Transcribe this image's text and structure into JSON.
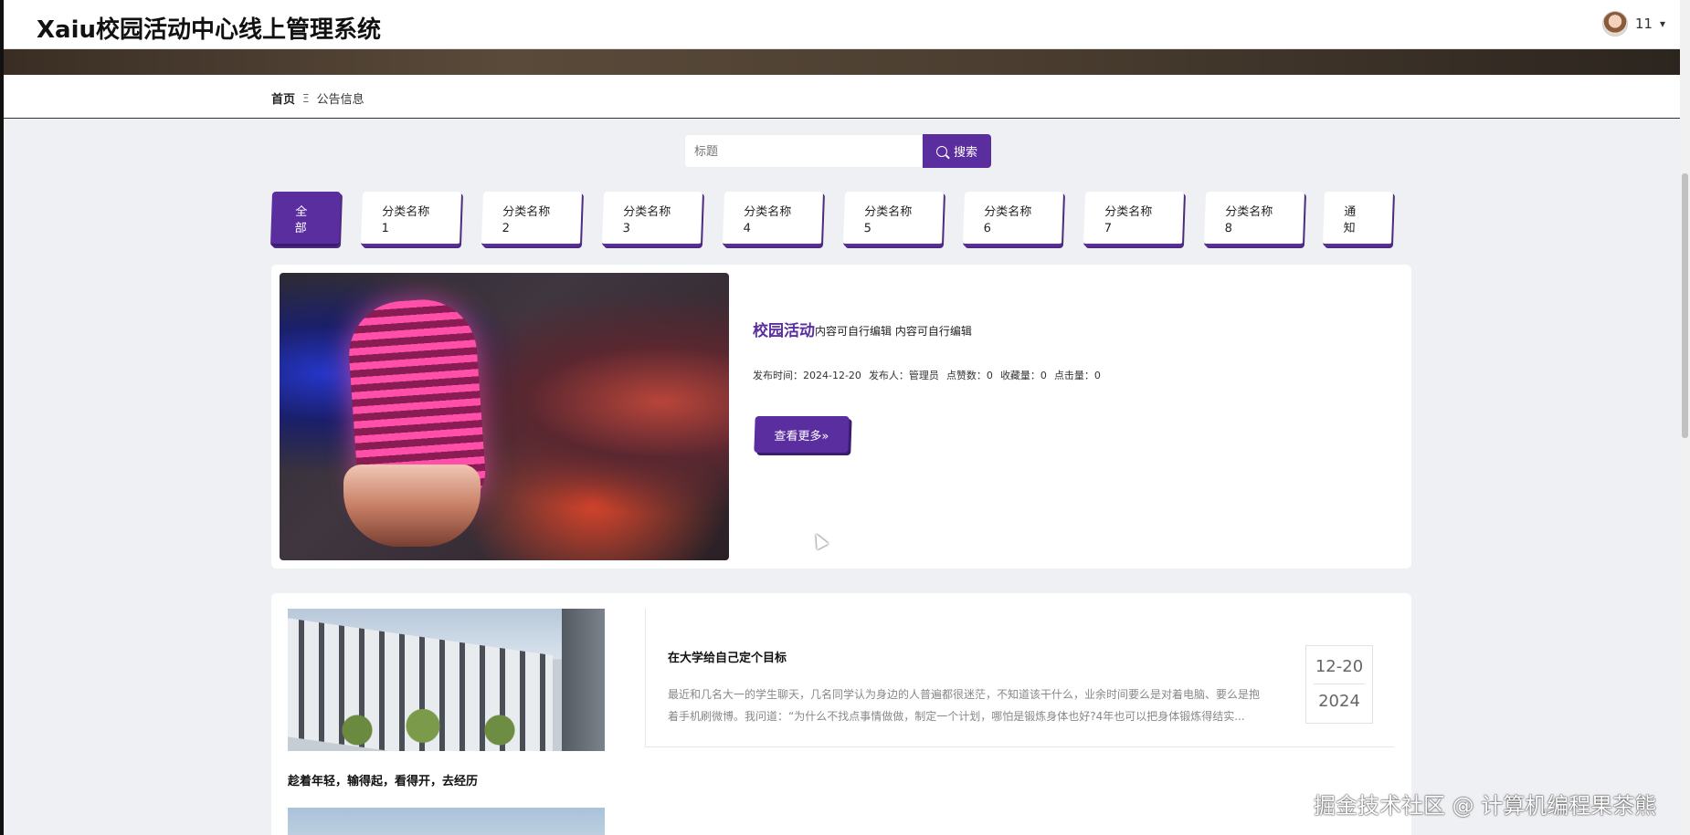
{
  "header": {
    "app_title": "Xaiu校园活动中心线上管理系统",
    "user_name": "11",
    "caret": "▾"
  },
  "breadcrumb": {
    "home": "首页",
    "separator": "Ξ",
    "current": "公告信息"
  },
  "search": {
    "placeholder": "标题",
    "button_label": "搜索"
  },
  "tabs": [
    {
      "line1": "全",
      "line2": "部",
      "active": true
    },
    {
      "line1": "分类名称",
      "line2": "1"
    },
    {
      "line1": "分类名称",
      "line2": "2"
    },
    {
      "line1": "分类名称",
      "line2": "3"
    },
    {
      "line1": "分类名称",
      "line2": "4"
    },
    {
      "line1": "分类名称",
      "line2": "5"
    },
    {
      "line1": "分类名称",
      "line2": "6"
    },
    {
      "line1": "分类名称",
      "line2": "7"
    },
    {
      "line1": "分类名称",
      "line2": "8"
    },
    {
      "line1": "通",
      "line2": "知"
    }
  ],
  "featured": {
    "title": "校园活动",
    "summary": "内容可自行编辑 内容可自行编辑",
    "meta": {
      "publish_time": "发布时间：2024-12-20",
      "publisher": "发布人：管理员",
      "likes": "点赞数：0",
      "favorites": "收藏量：0",
      "clicks": "点击量：0"
    },
    "more_label": "查看更多»"
  },
  "list": {
    "thumb_caption": "趁着年轻，输得起，看得开，去经历",
    "article": {
      "title": "在大学给自己定个目标",
      "excerpt": "最近和几名大一的学生聊天，几名同学认为身边的人普遍都很迷茫，不知道该干什么，业余时间要么是对着电脑、要么是抱着手机刷微博。我问道：“为什么不找点事情做做，制定一个计划，哪怕是锻炼身体也好?4年也可以把身体锻炼得结实...",
      "date_day": "12-20",
      "date_year": "2024"
    }
  },
  "watermark": "掘金技术社区 @ 计算机编程果茶熊",
  "colors": {
    "accent": "#5b2ea0",
    "page_bg": "#eff0f4"
  }
}
